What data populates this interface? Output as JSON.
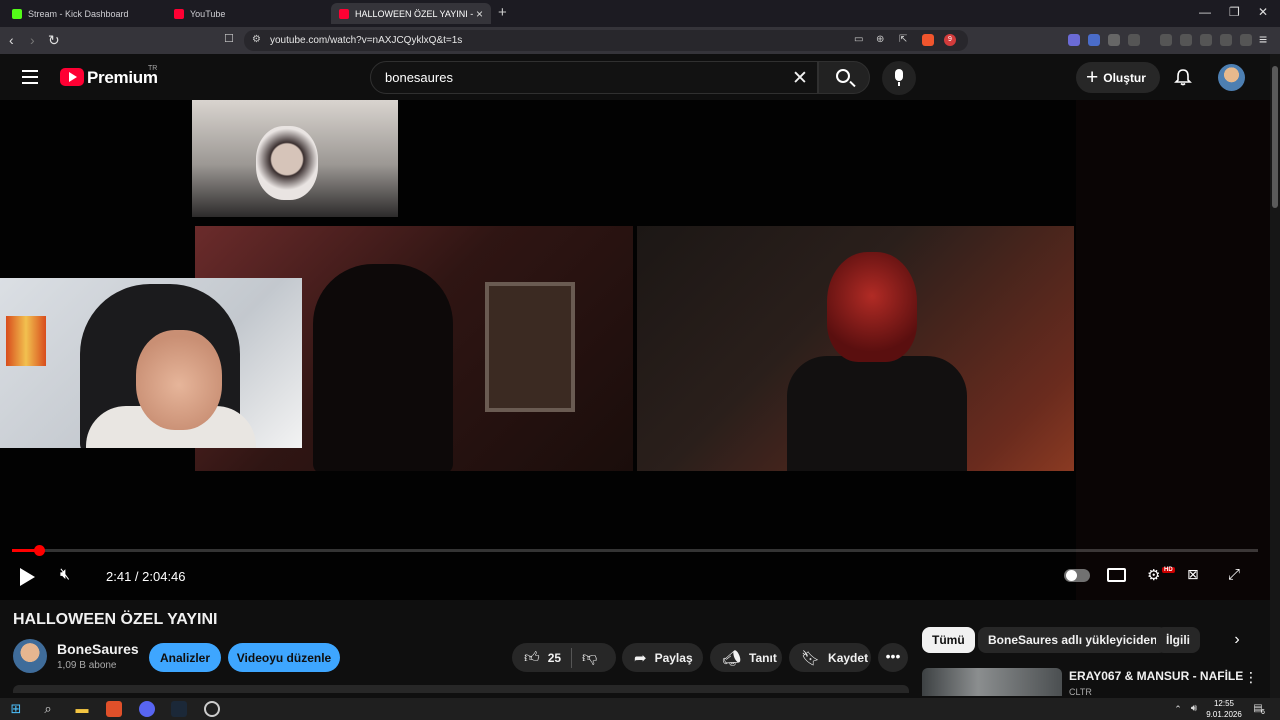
{
  "browser": {
    "tabs": [
      {
        "title": "Stream - Kick Dashboard",
        "fav_color": "#53fc18"
      },
      {
        "title": "YouTube",
        "fav_color": "#ff0033"
      },
      {
        "title": "HALLOWEEN ÖZEL YAYINI - YouTube",
        "fav_color": "#ff0033",
        "active": true
      }
    ],
    "new_tab": "+",
    "window_controls": {
      "minimize": "—",
      "maximize": "❐",
      "close": "✕"
    },
    "address": "youtube.com/watch?v=nAXJCQyklxQ&t=1s",
    "extension_badge": "9"
  },
  "header": {
    "brand": "Premium",
    "country": "TR",
    "search_value": "bonesaures",
    "create_label": "Oluştur"
  },
  "player": {
    "time": "2:41 / 2:04:46",
    "progress": 0.0216,
    "autoplay_on": false,
    "quality_badge": "HD"
  },
  "video": {
    "title": "HALLOWEEN ÖZEL YAYINI",
    "channel": "BoneSaures",
    "subscribers": "1,09 B abone",
    "analytics_label": "Analizler",
    "edit_label": "Videoyu düzenle",
    "likes": "25",
    "share_label": "Paylaş",
    "promote_label": "Tanıt",
    "save_label": "Kaydet"
  },
  "sidebar": {
    "chips": [
      "Tümü",
      "BoneSaures adlı yükleyiciden",
      "İlgili"
    ],
    "recommendation": {
      "title": "ERAY067 & MANSUR - NAFİLE",
      "channel": "CLTR"
    }
  },
  "taskbar": {
    "time": "12:55",
    "date": "9.01.2026",
    "notifications": "6"
  }
}
